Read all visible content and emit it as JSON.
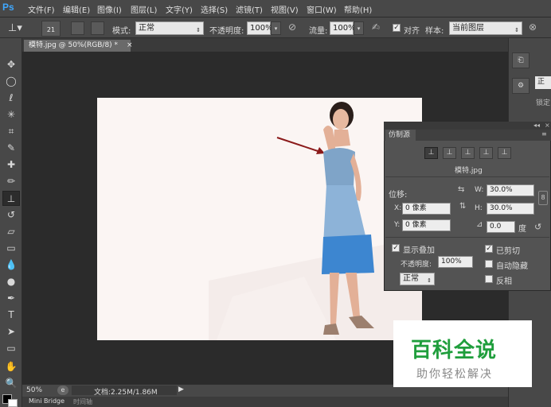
{
  "app": {
    "logo": "Ps"
  },
  "menu": [
    "文件(F)",
    "编辑(E)",
    "图像(I)",
    "图层(L)",
    "文字(Y)",
    "选择(S)",
    "滤镜(T)",
    "视图(V)",
    "窗口(W)",
    "帮助(H)"
  ],
  "options": {
    "brush_size": "21",
    "mode_label": "模式:",
    "mode_value": "正常",
    "opacity_label": "不透明度:",
    "opacity_value": "100%",
    "flow_label": "流量:",
    "flow_value": "100%",
    "align_label": "对齐",
    "sample_label": "样本:",
    "sample_value": "当前图层"
  },
  "document": {
    "tab_title": "模特.jpg @ 50%(RGB/8) *",
    "close": "×"
  },
  "status": {
    "zoom": "50%",
    "doc_info": "文档:2.25M/1.86M"
  },
  "bottom_tabs": [
    "Mini Bridge",
    "时间轴"
  ],
  "right_strip": {
    "label1": "锁定",
    "field": "正"
  },
  "clone_source": {
    "tab": "仿制源",
    "source_file": "模特.jpg",
    "offset_label": "位移:",
    "w_label": "W:",
    "w_value": "30.0%",
    "h_label": "H:",
    "h_value": "30.0%",
    "x_label": "X:",
    "x_value": "0 像素",
    "y_label": "Y:",
    "y_value": "0 像素",
    "angle_value": "0.0",
    "angle_unit": "度",
    "show_overlay": "显示叠加",
    "opacity_label": "不透明度:",
    "opacity_value": "100%",
    "blend_value": "正常",
    "clipped": "已剪切",
    "auto_hide": "自动隐藏",
    "invert": "反相"
  },
  "watermark": {
    "title": "百科全说",
    "subtitle": "助你轻松解决",
    "color": "#1f9e3c"
  }
}
